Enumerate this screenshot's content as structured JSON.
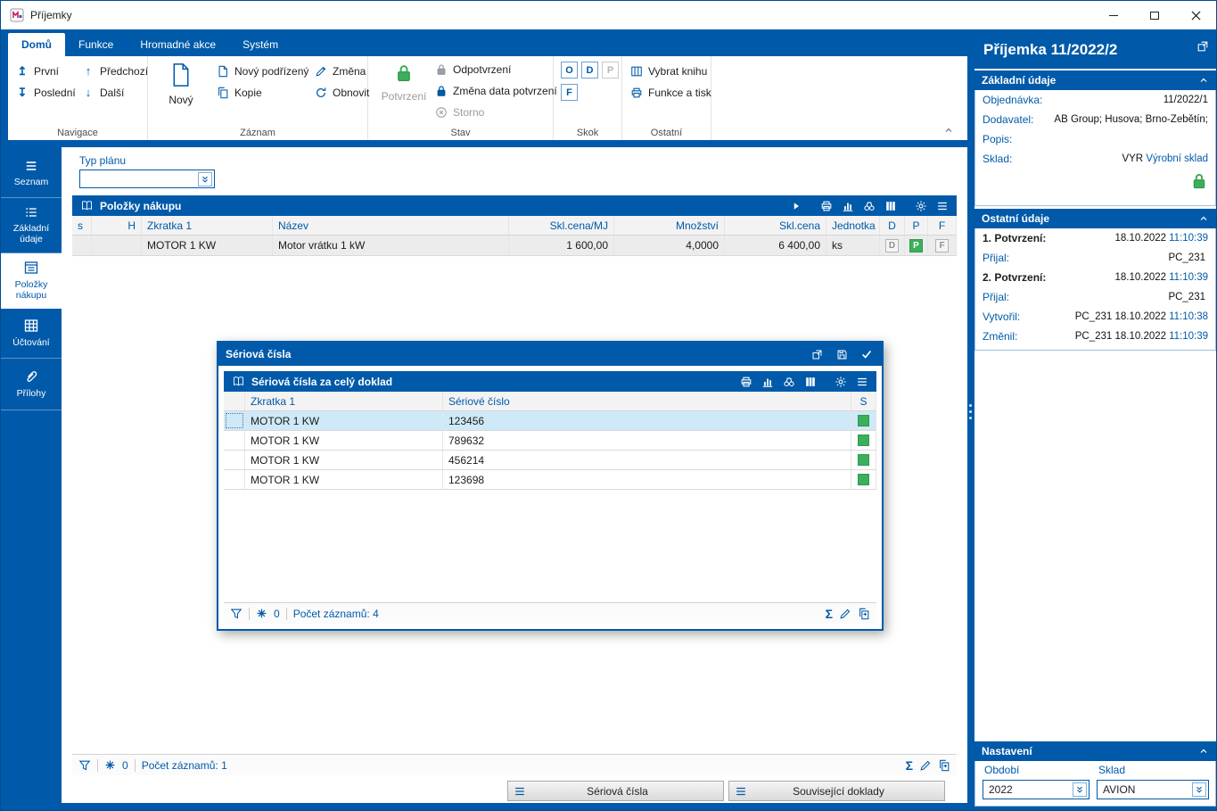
{
  "window": {
    "title": "Příjemky"
  },
  "icons": {
    "first": "↥",
    "last": "↧",
    "previous": "↑",
    "next": "↓",
    "sum": "Σ"
  },
  "ribbon": {
    "tabs": [
      "Domů",
      "Funkce",
      "Hromadné akce",
      "Systém"
    ],
    "navigace": {
      "group": "Navigace",
      "first": "První",
      "last": "Poslední",
      "previous": "Předchozí",
      "next": "Další"
    },
    "zaznam": {
      "group": "Záznam",
      "new": "Nový",
      "new_child": "Nový podřízený",
      "copy": "Kopie",
      "change": "Změna",
      "refresh": "Obnovit"
    },
    "stav": {
      "group": "Stav",
      "confirm": "Potvrzení",
      "unconfirm": "Odpotvrzení",
      "change_date": "Změna data potvrzení",
      "cancel": "Storno"
    },
    "skok": {
      "group": "Skok",
      "o": "O",
      "d": "D",
      "p": "P",
      "f": "F"
    },
    "ostatni": {
      "group": "Ostatní",
      "select_book": "Vybrat knihu",
      "functions_print": "Funkce a tisk"
    }
  },
  "sidebar": {
    "items": [
      {
        "label": "Seznam"
      },
      {
        "label": "Základní údaje"
      },
      {
        "label": "Položky nákupu"
      },
      {
        "label": "Účtování"
      },
      {
        "label": "Přílohy"
      }
    ]
  },
  "main": {
    "typ_planu": {
      "label": "Typ plánu",
      "value": ""
    },
    "grid": {
      "title": "Položky nákupu",
      "columns": {
        "s": "s",
        "h": "H",
        "zkratka": "Zkratka 1",
        "nazev": "Název",
        "cena_mj": "Skl.cena/MJ",
        "mnozstvi": "Množství",
        "cena": "Skl.cena",
        "jednotka": "Jednotka",
        "d": "D",
        "p": "P",
        "f": "F"
      },
      "row": {
        "zkratka": "MOTOR 1 KW",
        "nazev": "Motor vrátku 1 kW",
        "cena_mj": "1 600,00",
        "mnozstvi": "4,0000",
        "cena": "6 400,00",
        "jednotka": "ks",
        "d": "D",
        "p": "P",
        "f": "F"
      },
      "footer": {
        "count": "0",
        "records": "Počet záznamů: 1"
      }
    },
    "buttons": {
      "serial": "Sériová čísla",
      "related": "Související doklady"
    }
  },
  "dialog": {
    "title": "Sériová čísla",
    "grid": {
      "title": "Sériová čísla za celý doklad",
      "columns": {
        "zkratka": "Zkratka 1",
        "cislo": "Sériové číslo",
        "s": "S"
      },
      "rows": [
        {
          "zkratka": "MOTOR 1 KW",
          "cislo": "123456"
        },
        {
          "zkratka": "MOTOR 1 KW",
          "cislo": "789632"
        },
        {
          "zkratka": "MOTOR 1 KW",
          "cislo": "456214"
        },
        {
          "zkratka": "MOTOR 1 KW",
          "cislo": "123698"
        }
      ],
      "footer": {
        "count": "0",
        "records": "Počet záznamů: 4"
      }
    }
  },
  "panel": {
    "title": "Příjemka 11/2022/2",
    "zakladni": {
      "title": "Základní údaje",
      "objednavka_label": "Objednávka:",
      "objednavka": "11/2022/1",
      "dodavatel_label": "Dodavatel:",
      "dodavatel": "AB Group; Husova; Brno-Žebětín;",
      "popis_label": "Popis:",
      "popis": "",
      "sklad_label": "Sklad:",
      "sklad_code": "VYR",
      "sklad_name": "Výrobní sklad"
    },
    "ostatni": {
      "title": "Ostatní údaje",
      "rows": [
        {
          "label": "1. Potvrzení:",
          "value": "18.10.2022",
          "time": "11:10:39"
        },
        {
          "label": "Přijal:",
          "value": "PC_231",
          "time": ""
        },
        {
          "label": "2. Potvrzení:",
          "value": "18.10.2022",
          "time": "11:10:39"
        },
        {
          "label": "Přijal:",
          "value": "PC_231",
          "time": ""
        },
        {
          "label": "Vytvořil:",
          "value": "PC_231 18.10.2022",
          "time": "11:10:38"
        },
        {
          "label": "Změnil:",
          "value": "PC_231 18.10.2022",
          "time": "11:10:39"
        }
      ]
    },
    "nastaveni": {
      "title": "Nastavení",
      "obdobi_label": "Období",
      "obdobi": "2022",
      "sklad_label": "Sklad",
      "sklad": "AVION"
    }
  }
}
